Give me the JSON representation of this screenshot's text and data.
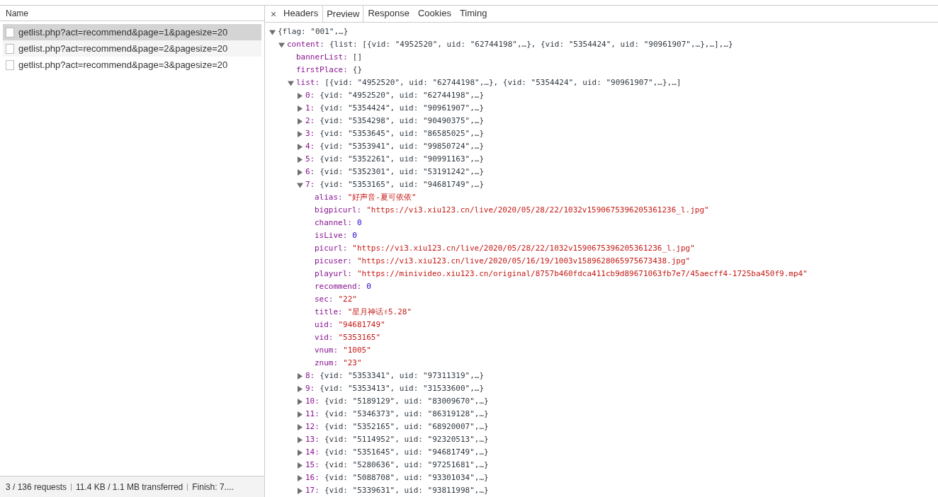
{
  "requests": {
    "column": "Name",
    "items": [
      {
        "name": "getlist.php?act=recommend&page=1&pagesize=20",
        "selected": true
      },
      {
        "name": "getlist.php?act=recommend&page=2&pagesize=20",
        "selected": false
      },
      {
        "name": "getlist.php?act=recommend&page=3&pagesize=20",
        "selected": false
      }
    ]
  },
  "status_bar": [
    "3 / 136 requests",
    "11.4 KB / 1.1 MB transferred",
    "Finish: 7...."
  ],
  "detail": {
    "close": "×",
    "tabs": [
      {
        "label": "Headers",
        "selected": false
      },
      {
        "label": "Preview",
        "selected": true
      },
      {
        "label": "Response",
        "selected": false
      },
      {
        "label": "Cookies",
        "selected": false
      },
      {
        "label": "Timing",
        "selected": false
      }
    ],
    "preview": [
      {
        "summary": "{flag: \"001\",…}",
        "expanded": true,
        "children": [
          {
            "key": "content:",
            "summary": "{list: [{vid: \"4952520\", uid: \"62744198\",…}, {vid: \"5354424\", uid: \"90961907\",…},…],…}",
            "expanded": true,
            "children": [
              {
                "key": "bannerList:",
                "value": "[]",
                "kind": "literal"
              },
              {
                "key": "firstPlace:",
                "value": "{}",
                "kind": "literal"
              },
              {
                "key": "list:",
                "summary": "[{vid: \"4952520\", uid: \"62744198\",…}, {vid: \"5354424\", uid: \"90961907\",…},…]",
                "expanded": true,
                "children": [
                  {
                    "key": "0:",
                    "summary": "{vid: \"4952520\", uid: \"62744198\",…}",
                    "expanded": false
                  },
                  {
                    "key": "1:",
                    "summary": "{vid: \"5354424\", uid: \"90961907\",…}",
                    "expanded": false
                  },
                  {
                    "key": "2:",
                    "summary": "{vid: \"5354298\", uid: \"90490375\",…}",
                    "expanded": false
                  },
                  {
                    "key": "3:",
                    "summary": "{vid: \"5353645\", uid: \"86585025\",…}",
                    "expanded": false
                  },
                  {
                    "key": "4:",
                    "summary": "{vid: \"5353941\", uid: \"99850724\",…}",
                    "expanded": false
                  },
                  {
                    "key": "5:",
                    "summary": "{vid: \"5352261\", uid: \"90991163\",…}",
                    "expanded": false
                  },
                  {
                    "key": "6:",
                    "summary": "{vid: \"5352301\", uid: \"53191242\",…}",
                    "expanded": false
                  },
                  {
                    "key": "7:",
                    "summary": "{vid: \"5353165\", uid: \"94681749\",…}",
                    "expanded": true,
                    "children": [
                      {
                        "key": "alias:",
                        "value": "\"好声音-夏可依依\"",
                        "kind": "string"
                      },
                      {
                        "key": "bigpicurl:",
                        "value": "\"https://vi3.xiu123.cn/live/2020/05/28/22/1032v1590675396205361236_l.jpg\"",
                        "kind": "string"
                      },
                      {
                        "key": "channel:",
                        "value": "0",
                        "kind": "number"
                      },
                      {
                        "key": "isLive:",
                        "value": "0",
                        "kind": "number"
                      },
                      {
                        "key": "picurl:",
                        "value": "\"https://vi3.xiu123.cn/live/2020/05/28/22/1032v1590675396205361236_l.jpg\"",
                        "kind": "string"
                      },
                      {
                        "key": "picuser:",
                        "value": "\"https://vi3.xiu123.cn/live/2020/05/16/19/1003v1589628065975673438.jpg\"",
                        "kind": "string"
                      },
                      {
                        "key": "playurl:",
                        "value": "\"https://minivideo.xiu123.cn/original/8757b460fdca411cb9d89671063fb7e7/45aecff4-1725ba450f9.mp4\"",
                        "kind": "string"
                      },
                      {
                        "key": "recommend:",
                        "value": "0",
                        "kind": "number"
                      },
                      {
                        "key": "sec:",
                        "value": "\"22\"",
                        "kind": "string"
                      },
                      {
                        "key": "title:",
                        "value": "\"星月神话✌5.28\"",
                        "kind": "string"
                      },
                      {
                        "key": "uid:",
                        "value": "\"94681749\"",
                        "kind": "string"
                      },
                      {
                        "key": "vid:",
                        "value": "\"5353165\"",
                        "kind": "string"
                      },
                      {
                        "key": "vnum:",
                        "value": "\"1005\"",
                        "kind": "string"
                      },
                      {
                        "key": "znum:",
                        "value": "\"23\"",
                        "kind": "string"
                      }
                    ]
                  },
                  {
                    "key": "8:",
                    "summary": "{vid: \"5353341\", uid: \"97311319\",…}",
                    "expanded": false
                  },
                  {
                    "key": "9:",
                    "summary": "{vid: \"5353413\", uid: \"31533600\",…}",
                    "expanded": false
                  },
                  {
                    "key": "10:",
                    "summary": "{vid: \"5189129\", uid: \"83009670\",…}",
                    "expanded": false
                  },
                  {
                    "key": "11:",
                    "summary": "{vid: \"5346373\", uid: \"86319128\",…}",
                    "expanded": false
                  },
                  {
                    "key": "12:",
                    "summary": "{vid: \"5352165\", uid: \"68920007\",…}",
                    "expanded": false
                  },
                  {
                    "key": "13:",
                    "summary": "{vid: \"5114952\", uid: \"92320513\",…}",
                    "expanded": false
                  },
                  {
                    "key": "14:",
                    "summary": "{vid: \"5351645\", uid: \"94681749\",…}",
                    "expanded": false
                  },
                  {
                    "key": "15:",
                    "summary": "{vid: \"5280636\", uid: \"97251681\",…}",
                    "expanded": false
                  },
                  {
                    "key": "16:",
                    "summary": "{vid: \"5088708\", uid: \"93301034\",…}",
                    "expanded": false
                  },
                  {
                    "key": "17:",
                    "summary": "{vid: \"5339631\", uid: \"93811998\",…}",
                    "expanded": false
                  }
                ]
              }
            ]
          }
        ]
      }
    ]
  }
}
